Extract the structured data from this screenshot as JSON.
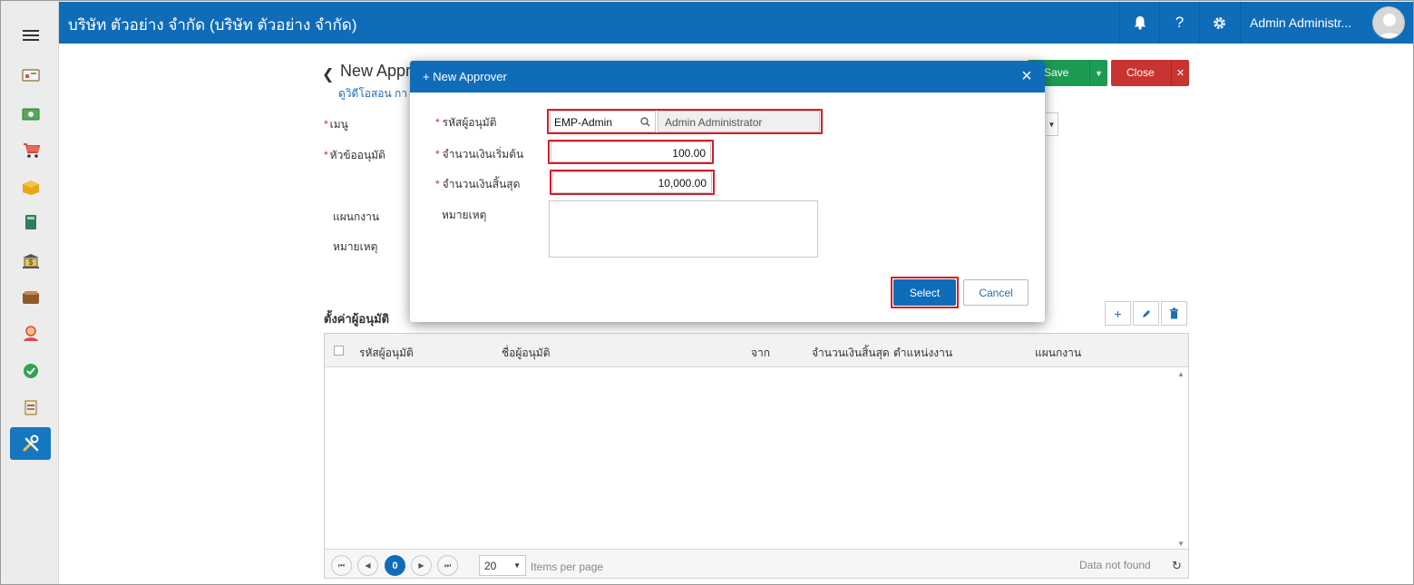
{
  "header": {
    "company": "บริษัท ตัวอย่าง จำกัด (บริษัท ตัวอย่าง จำกัด)",
    "user_name": "Admin Administr..."
  },
  "icons": {
    "menu": "hamburger-icon",
    "bell": "bell-icon",
    "help": "?",
    "settings": "gear-icon"
  },
  "sidebar": {
    "items": [
      {
        "name": "dashboard-icon"
      },
      {
        "name": "money-icon"
      },
      {
        "name": "cart-icon"
      },
      {
        "name": "box-icon"
      },
      {
        "name": "book-icon"
      },
      {
        "name": "bank-icon"
      },
      {
        "name": "wallet-icon"
      },
      {
        "name": "people-icon"
      },
      {
        "name": "check-circle-icon"
      },
      {
        "name": "report-icon"
      },
      {
        "name": "tools-icon",
        "active": true
      }
    ]
  },
  "page": {
    "title": "New Appr",
    "subtitle": "ดูวิดีโอสอน กา",
    "save_label": "Save",
    "close_label": "Close",
    "form_labels": {
      "menu": "เมนู",
      "approval_topic": "หัวข้ออนุมัติ",
      "department": "แผนกงาน",
      "note": "หมายเหตุ"
    },
    "section_title": "ตั้งค่าผู้อนุมัติ"
  },
  "grid": {
    "columns": [
      "รหัสผู้อนุมัติ",
      "ชื่อผู้อนุมัติ",
      "จาก",
      "จำนวนเงินสิ้นสุด",
      "ตำแหน่งงาน",
      "แผนกงาน"
    ],
    "pager": {
      "current_page": "0",
      "page_size": "20",
      "items_per_page_label": "Items per page",
      "empty_text": "Data not found"
    }
  },
  "modal": {
    "title": "+ New Approver",
    "fields": {
      "approver_code_label": "รหัสผู้อนุมัติ",
      "approver_code_value": "EMP-Admin",
      "approver_name_value": "Admin Administrator",
      "start_amount_label": "จำนวนเงินเริ่มต้น",
      "start_amount_value": "100.00",
      "end_amount_label": "จำนวนเงินสิ้นสุด",
      "end_amount_value": "10,000.00",
      "note_label": "หมายเหตุ",
      "note_value": ""
    },
    "select_label": "Select",
    "cancel_label": "Cancel"
  },
  "colors": {
    "primary": "#0f6cb8",
    "save": "#1d9b55",
    "close": "#c83431",
    "highlight": "#d0202a",
    "required": "#d32f2f"
  }
}
